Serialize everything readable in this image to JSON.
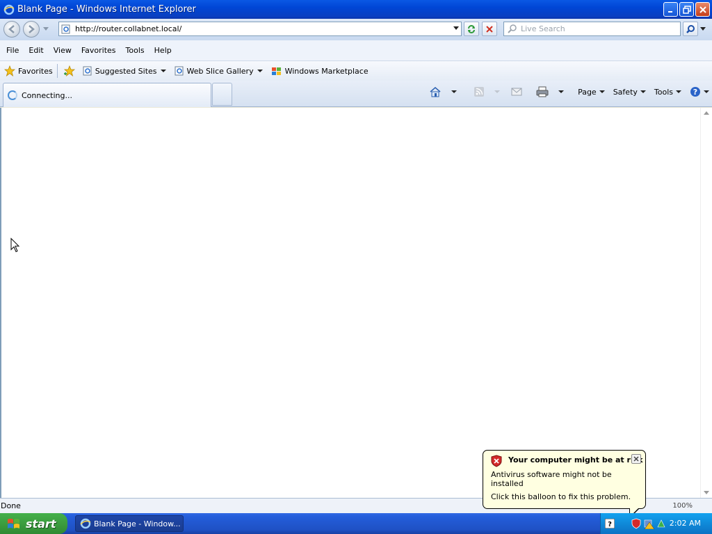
{
  "window": {
    "title": "Blank Page - Windows Internet Explorer"
  },
  "address": {
    "url": "http://router.collabnet.local/"
  },
  "search": {
    "placeholder": "Live Search"
  },
  "menu": [
    "File",
    "Edit",
    "View",
    "Favorites",
    "Tools",
    "Help"
  ],
  "favorites_bar": {
    "favorites_label": "Favorites",
    "suggested_sites": "Suggested Sites",
    "web_slice_gallery": "Web Slice Gallery",
    "windows_marketplace": "Windows Marketplace"
  },
  "tab": {
    "label": "Connecting..."
  },
  "command_bar": {
    "page": "Page",
    "safety": "Safety",
    "tools": "Tools"
  },
  "status": {
    "text": "Done",
    "zoom": "100%"
  },
  "balloon": {
    "title": "Your computer might be at risk",
    "line1": "Antivirus software might not be installed",
    "line2": "Click this balloon to fix this problem."
  },
  "taskbar": {
    "start_label": "start",
    "task_label": "Blank Page - Window...",
    "clock": "2:02 AM"
  },
  "colors": {
    "title_bar": "#0046d5",
    "taskbar": "#245edb",
    "start_button": "#3c9d3f",
    "balloon_bg": "#ffffe1"
  }
}
